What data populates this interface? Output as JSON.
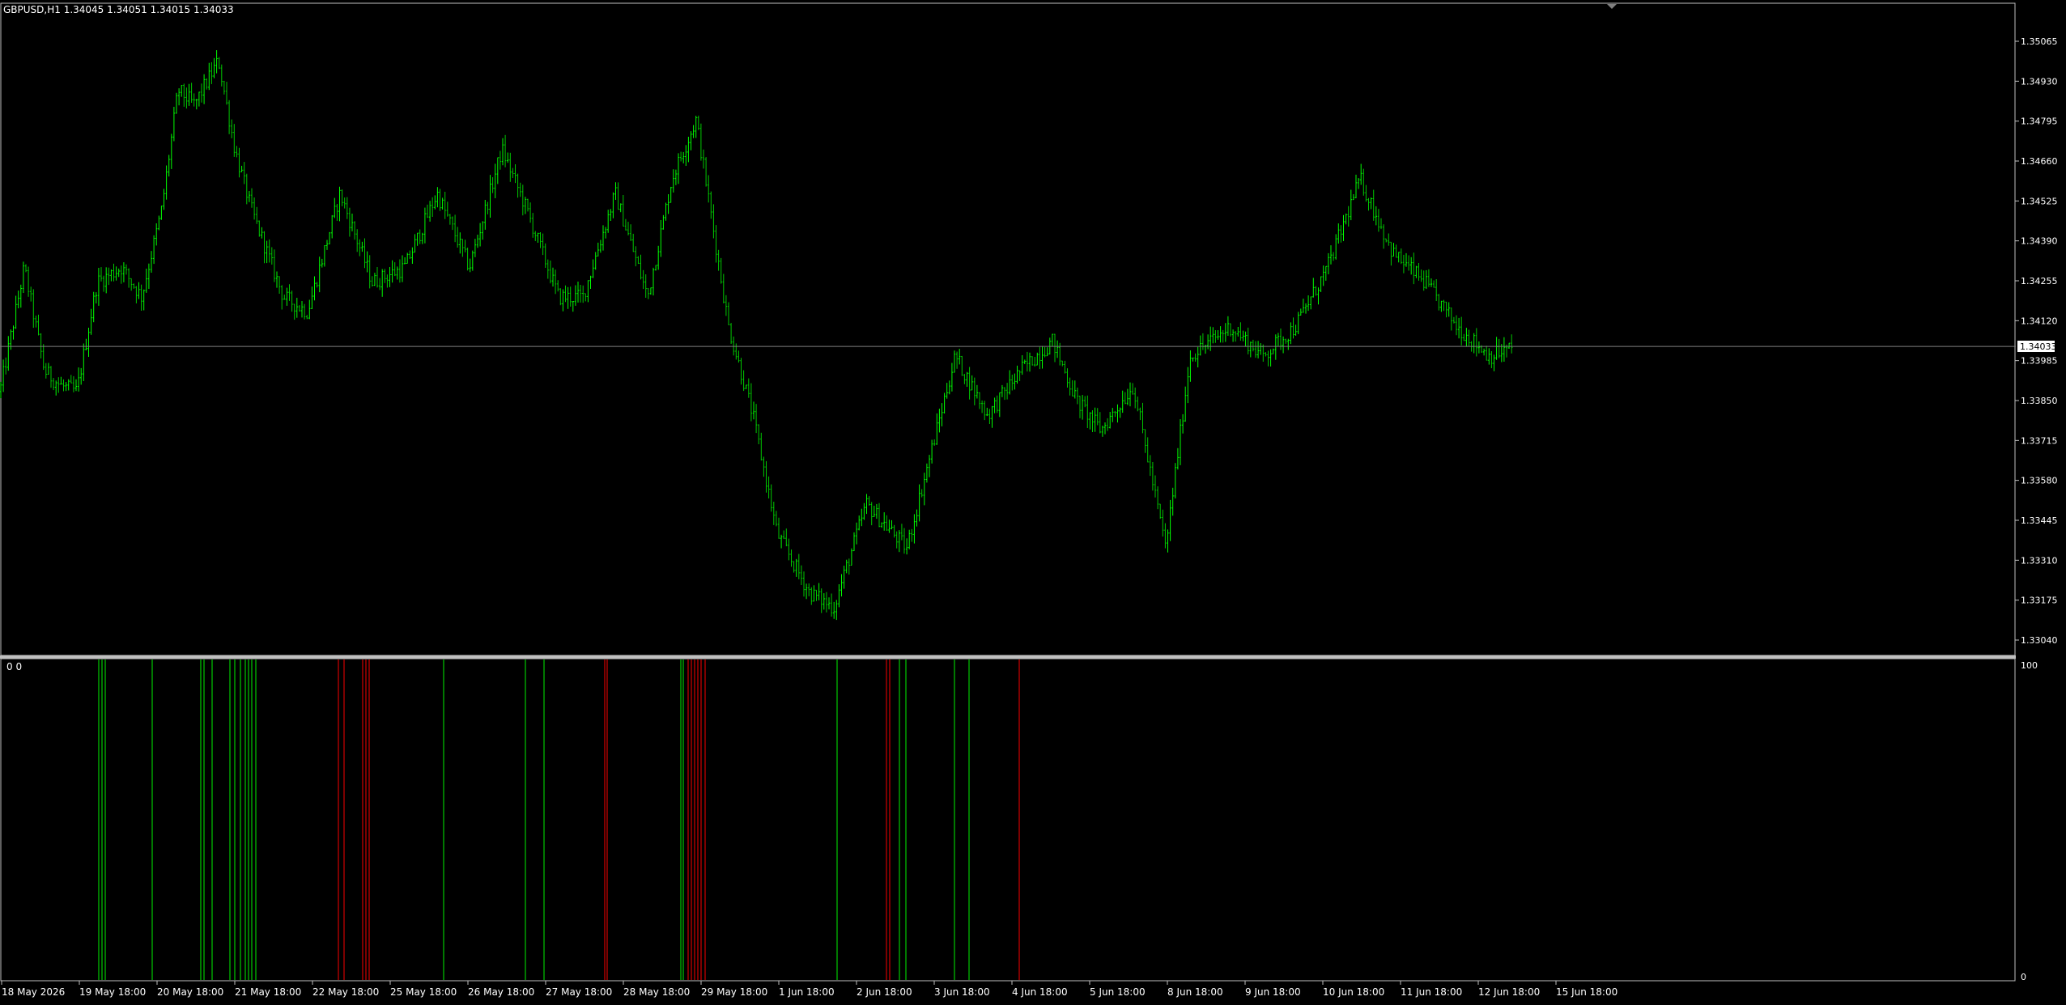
{
  "header": {
    "symbol": "GBPUSD,H1",
    "ohlc": "1.34045 1.34051 1.34015 1.34033",
    "text": "GBPUSD,H1  1.34045 1.34051 1.34015 1.34033"
  },
  "colors": {
    "background": "#000000",
    "bull": "#00ff00",
    "bear": "#00c800",
    "grid_border": "#ffffff",
    "bid_line": "#808080",
    "signal_up": "#00c800",
    "signal_down": "#d00000"
  },
  "price_axis": {
    "ticks": [
      "1.35065",
      "1.34930",
      "1.34795",
      "1.34660",
      "1.34525",
      "1.34390",
      "1.34255",
      "1.34120",
      "1.33985",
      "1.33850",
      "1.33715",
      "1.33580",
      "1.33445",
      "1.33310",
      "1.33175",
      "1.33040"
    ],
    "current_price": "1.34033"
  },
  "sub_window": {
    "label": "0 0",
    "scale_max": "100",
    "scale_min": "0"
  },
  "time_axis": {
    "labels": [
      "18 May 2026",
      "19 May 18:00",
      "20 May 18:00",
      "21 May 18:00",
      "22 May 18:00",
      "25 May 18:00",
      "26 May 18:00",
      "27 May 18:00",
      "28 May 18:00",
      "29 May 18:00",
      "1 Jun 18:00",
      "2 Jun 18:00",
      "3 Jun 18:00",
      "4 Jun 18:00",
      "5 Jun 18:00",
      "8 Jun 18:00",
      "9 Jun 18:00",
      "10 Jun 18:00",
      "11 Jun 18:00",
      "12 Jun 18:00",
      "15 Jun 18:00"
    ]
  },
  "chart_data": {
    "type": "candlestick",
    "title": "GBPUSD,H1",
    "ylim": [
      1.33,
      1.3515
    ],
    "close_path": [
      [
        0,
        1.3388
      ],
      [
        0.03,
        1.343
      ],
      [
        0.055,
        1.3395
      ],
      [
        0.075,
        1.339
      ],
      [
        0.095,
        1.3388
      ],
      [
        0.12,
        1.3425
      ],
      [
        0.15,
        1.343
      ],
      [
        0.175,
        1.342
      ],
      [
        0.2,
        1.345
      ],
      [
        0.22,
        1.349
      ],
      [
        0.24,
        1.3485
      ],
      [
        0.27,
        1.35
      ],
      [
        0.29,
        1.347
      ],
      [
        0.31,
        1.345
      ],
      [
        0.35,
        1.342
      ],
      [
        0.38,
        1.3415
      ],
      [
        0.42,
        1.3455
      ],
      [
        0.46,
        1.3425
      ],
      [
        0.5,
        1.343
      ],
      [
        0.54,
        1.3455
      ],
      [
        0.58,
        1.343
      ],
      [
        0.62,
        1.347
      ],
      [
        0.65,
        1.345
      ],
      [
        0.69,
        1.342
      ],
      [
        0.72,
        1.342
      ],
      [
        0.76,
        1.3455
      ],
      [
        0.8,
        1.342
      ],
      [
        0.83,
        1.346
      ],
      [
        0.86,
        1.348
      ],
      [
        0.9,
        1.341
      ],
      [
        0.93,
        1.338
      ],
      [
        0.96,
        1.334
      ],
      [
        1.0,
        1.332
      ],
      [
        1.03,
        1.3315
      ],
      [
        1.07,
        1.335
      ],
      [
        1.12,
        1.3335
      ],
      [
        1.18,
        1.34
      ],
      [
        1.22,
        1.338
      ],
      [
        1.26,
        1.3395
      ],
      [
        1.3,
        1.3405
      ],
      [
        1.33,
        1.3385
      ],
      [
        1.36,
        1.3375
      ],
      [
        1.4,
        1.339
      ],
      [
        1.44,
        1.3335
      ],
      [
        1.47,
        1.34
      ],
      [
        1.52,
        1.341
      ],
      [
        1.56,
        1.34
      ],
      [
        1.6,
        1.341
      ],
      [
        1.64,
        1.343
      ],
      [
        1.68,
        1.346
      ],
      [
        1.72,
        1.3435
      ],
      [
        1.76,
        1.3425
      ],
      [
        1.8,
        1.341
      ],
      [
        1.84,
        1.34
      ],
      [
        1.87,
        1.3403
      ]
    ],
    "signals": [
      {
        "x": 0.122,
        "dir": "up"
      },
      {
        "x": 0.126,
        "dir": "up"
      },
      {
        "x": 0.13,
        "dir": "up"
      },
      {
        "x": 0.188,
        "dir": "up"
      },
      {
        "x": 0.248,
        "dir": "up"
      },
      {
        "x": 0.252,
        "dir": "up"
      },
      {
        "x": 0.262,
        "dir": "up"
      },
      {
        "x": 0.284,
        "dir": "up"
      },
      {
        "x": 0.29,
        "dir": "up"
      },
      {
        "x": 0.297,
        "dir": "up"
      },
      {
        "x": 0.303,
        "dir": "up"
      },
      {
        "x": 0.307,
        "dir": "up"
      },
      {
        "x": 0.311,
        "dir": "up"
      },
      {
        "x": 0.316,
        "dir": "up"
      },
      {
        "x": 0.418,
        "dir": "down"
      },
      {
        "x": 0.425,
        "dir": "down"
      },
      {
        "x": 0.448,
        "dir": "down"
      },
      {
        "x": 0.452,
        "dir": "down"
      },
      {
        "x": 0.456,
        "dir": "down"
      },
      {
        "x": 0.548,
        "dir": "up"
      },
      {
        "x": 0.649,
        "dir": "up"
      },
      {
        "x": 0.672,
        "dir": "up"
      },
      {
        "x": 0.747,
        "dir": "down"
      },
      {
        "x": 0.75,
        "dir": "down"
      },
      {
        "x": 0.841,
        "dir": "up"
      },
      {
        "x": 0.844,
        "dir": "up"
      },
      {
        "x": 0.85,
        "dir": "down"
      },
      {
        "x": 0.854,
        "dir": "down"
      },
      {
        "x": 0.858,
        "dir": "down"
      },
      {
        "x": 0.862,
        "dir": "down"
      },
      {
        "x": 0.866,
        "dir": "down"
      },
      {
        "x": 0.871,
        "dir": "down"
      },
      {
        "x": 1.034,
        "dir": "up"
      },
      {
        "x": 1.095,
        "dir": "down"
      },
      {
        "x": 1.099,
        "dir": "down"
      },
      {
        "x": 1.111,
        "dir": "up"
      },
      {
        "x": 1.119,
        "dir": "up"
      },
      {
        "x": 1.179,
        "dir": "up"
      },
      {
        "x": 1.197,
        "dir": "up"
      },
      {
        "x": 1.259,
        "dir": "down"
      }
    ]
  }
}
